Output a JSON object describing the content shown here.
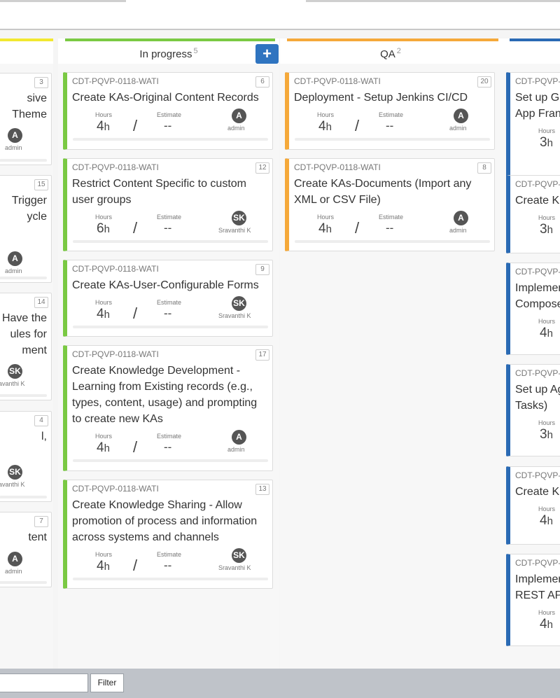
{
  "columns": {
    "left": {
      "color": "#f2e830"
    },
    "inprogress": {
      "title": "In progress",
      "count": "5",
      "color": "#7ac943",
      "add_icon": "+"
    },
    "qa": {
      "title": "QA",
      "count": "2",
      "color": "#f5a93a"
    },
    "right": {
      "color": "#2a6ab4"
    }
  },
  "labels": {
    "hours": "Hours",
    "estimate": "Estimate",
    "unit": "h",
    "slash": "/",
    "dash": "--"
  },
  "left_cards": [
    {
      "num": "3",
      "lines": [
        "sive",
        " Theme"
      ],
      "avatar": "A",
      "assignee": "admin"
    },
    {
      "num": "15",
      "lines": [
        "Trigger",
        "ycle"
      ],
      "avatar": "A",
      "assignee": "admin"
    },
    {
      "num": "14",
      "lines": [
        "Have the",
        "ules for",
        "ment"
      ],
      "avatar": "SK",
      "assignee": "Sravanthi K"
    },
    {
      "num": "4",
      "lines": [
        "l,"
      ],
      "avatar": "SK",
      "assignee": "Sravanthi K"
    },
    {
      "num": "7",
      "lines": [
        "tent"
      ],
      "avatar": "A",
      "assignee": "admin"
    }
  ],
  "inprogress_cards": [
    {
      "code": "CDT-PQVP-0118-WATI",
      "num": "6",
      "lines": [
        "Create KAs-Original Content Records"
      ],
      "hours": "4",
      "estimate": "--",
      "avatar": "A",
      "assignee": "admin"
    },
    {
      "code": "CDT-PQVP-0118-WATI",
      "num": "12",
      "lines": [
        "Restrict Content Specific to custom",
        "user groups"
      ],
      "hours": "6",
      "estimate": "--",
      "avatar": "SK",
      "assignee": "Sravanthi K"
    },
    {
      "code": "CDT-PQVP-0118-WATI",
      "num": "9",
      "lines": [
        "Create KAs-User-Configurable Forms"
      ],
      "hours": "4",
      "estimate": "--",
      "avatar": "SK",
      "assignee": "Sravanthi K"
    },
    {
      "code": "CDT-PQVP-0118-WATI",
      "num": "17",
      "lines": [
        "Create Knowledge Development -",
        "Learning from Existing records (e.g.,",
        "types, content, usage) and prompting",
        "to create new KAs"
      ],
      "hours": "4",
      "estimate": "--",
      "avatar": "A",
      "assignee": "admin"
    },
    {
      "code": "CDT-PQVP-0118-WATI",
      "num": "13",
      "lines": [
        "Create Knowledge Sharing - Allow",
        "promotion of process and information",
        "across systems and channels"
      ],
      "hours": "4",
      "estimate": "--",
      "avatar": "SK",
      "assignee": "Sravanthi K"
    }
  ],
  "qa_cards": [
    {
      "code": "CDT-PQVP-0118-WATI",
      "num": "20",
      "lines": [
        "Deployment - Setup Jenkins CI/CD"
      ],
      "hours": "4",
      "estimate": "--",
      "avatar": "A",
      "assignee": "admin"
    },
    {
      "code": "CDT-PQVP-0118-WATI",
      "num": "8",
      "lines": [
        "Create KAs-Documents (Import any",
        "XML or CSV File)"
      ],
      "hours": "4",
      "estimate": "--",
      "avatar": "A",
      "assignee": "admin"
    }
  ],
  "right_cards": [
    {
      "code": "CDT-PQVP-",
      "lines": [
        "Set up G",
        "App Fran"
      ],
      "hours": "3"
    },
    {
      "code": "CDT-PQVP-",
      "lines": [
        "Create K"
      ],
      "hours": "3"
    },
    {
      "code": "CDT-PQVP-",
      "lines": [
        "Implemen",
        "Compose"
      ],
      "hours": "4"
    },
    {
      "code": "CDT-PQVP-",
      "lines": [
        "Set up Ag",
        "Tasks)"
      ],
      "hours": "3"
    },
    {
      "code": "CDT-PQVP-",
      "lines": [
        "Create K"
      ],
      "hours": "4"
    },
    {
      "code": "CDT-PQVP-",
      "lines": [
        "Implemen",
        "REST AP"
      ],
      "hours": "4"
    }
  ],
  "footer": {
    "filter_value": "",
    "filter_button": "Filter"
  }
}
